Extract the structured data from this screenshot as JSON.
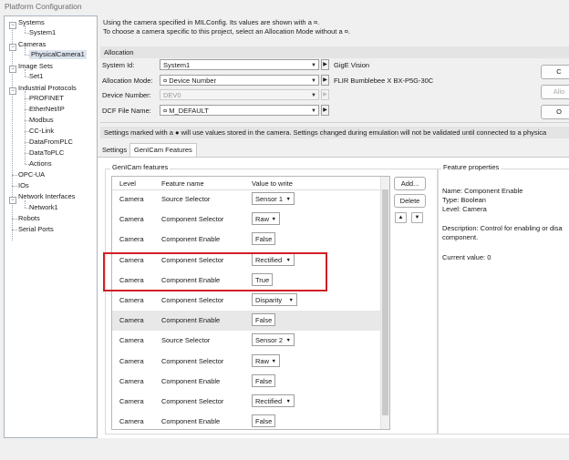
{
  "window": {
    "title": "Platform Configuration"
  },
  "tree": {
    "systems": "Systems",
    "system1": "System1",
    "cameras": "Cameras",
    "physical_camera1": "PhysicalCamera1",
    "image_sets": "Image Sets",
    "set1": "Set1",
    "industrial_protocols": "Industrial Protocols",
    "profinet": "PROFINET",
    "ethernet_ip": "EtherNet/IP",
    "modbus": "Modbus",
    "cc_link": "CC-Link",
    "data_from_plc": "DataFromPLC",
    "data_to_plc": "DataToPLC",
    "actions": "Actions",
    "opc_ua": "OPC-UA",
    "ios": "IOs",
    "network_interfaces": "Network Interfaces",
    "network1": "Network1",
    "robots": "Robots",
    "serial_ports": "Serial Ports"
  },
  "info": {
    "line1": "Using the camera specified in MILConfig.  Its values are shown with a ¤.",
    "line2": "To choose a camera specific to this project, select an Allocation Mode without a ¤."
  },
  "allocation": {
    "header": "Allocation",
    "system_id_label": "System Id:",
    "system_id_value": "System1",
    "mode_label": "Allocation Mode:",
    "mode_value": "¤ Device Number",
    "device_number_label": "Device Number:",
    "device_number_value": "DEV0",
    "dcf_label": "DCF File Name:",
    "dcf_value": "¤ M_DEFAULT",
    "gige_text": "GigE Vision",
    "camera_model": "FLIR Bumblebee X BX-P5G-30C",
    "btn1": "C",
    "btn2": "Allo",
    "btn3": "O"
  },
  "notice": "Settings marked with a ● will use values stored in the camera.  Settings changed during emulation will not be validated until connected to a physica",
  "tabs": {
    "settings": "Settings",
    "genicam": "GenICam Features"
  },
  "genicam": {
    "group_title": "GenICam features",
    "headers": {
      "level": "Level",
      "feature": "Feature name",
      "value": "Value to write"
    },
    "rows": [
      {
        "level": "Camera",
        "feature": "Source Selector",
        "value": "Sensor 1",
        "dropdown": true
      },
      {
        "level": "Camera",
        "feature": "Component Selector",
        "value": "Raw",
        "dropdown": true
      },
      {
        "level": "Camera",
        "feature": "Component Enable",
        "value": "False",
        "dropdown": false
      },
      {
        "level": "Camera",
        "feature": "Component Selector",
        "value": "Rectified",
        "dropdown": true
      },
      {
        "level": "Camera",
        "feature": "Component Enable",
        "value": "True",
        "dropdown": false
      },
      {
        "level": "Camera",
        "feature": "Component Selector",
        "value": "Disparity",
        "dropdown": true
      },
      {
        "level": "Camera",
        "feature": "Component Enable",
        "value": "False",
        "dropdown": false
      },
      {
        "level": "Camera",
        "feature": "Source Selector",
        "value": "Sensor 2",
        "dropdown": true
      },
      {
        "level": "Camera",
        "feature": "Component Selector",
        "value": "Raw",
        "dropdown": true
      },
      {
        "level": "Camera",
        "feature": "Component Enable",
        "value": "False",
        "dropdown": false
      },
      {
        "level": "Camera",
        "feature": "Component Selector",
        "value": "Rectified",
        "dropdown": true
      },
      {
        "level": "Camera",
        "feature": "Component Enable",
        "value": "False",
        "dropdown": false
      }
    ],
    "add_button": "Add...",
    "delete_button": "Delete"
  },
  "feature_properties": {
    "title": "Feature properties",
    "name": "Name: Component Enable",
    "type": "Type: Boolean",
    "level": "Level: Camera",
    "description_line1": "Description: Control for enabling or disa",
    "description_line2": "component.",
    "current_value": "Current value: 0"
  },
  "colors": {
    "highlight_box": "#d21f26",
    "selected_row": "#e8e8e8",
    "selected_tree": "#dde4ee"
  }
}
